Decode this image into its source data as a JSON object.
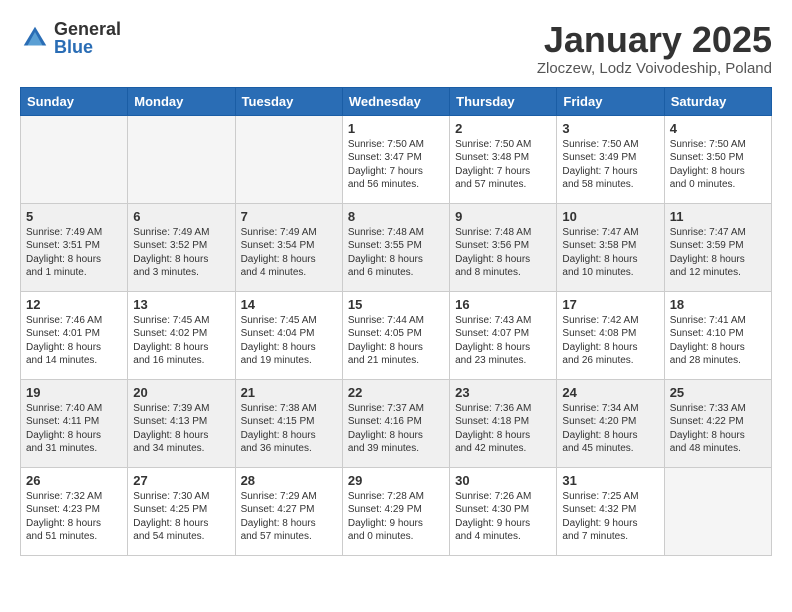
{
  "logo": {
    "general": "General",
    "blue": "Blue"
  },
  "title": "January 2025",
  "location": "Zloczew, Lodz Voivodeship, Poland",
  "weekdays": [
    "Sunday",
    "Monday",
    "Tuesday",
    "Wednesday",
    "Thursday",
    "Friday",
    "Saturday"
  ],
  "weeks": [
    {
      "shaded": false,
      "days": [
        {
          "num": "",
          "info": ""
        },
        {
          "num": "",
          "info": ""
        },
        {
          "num": "",
          "info": ""
        },
        {
          "num": "1",
          "info": "Sunrise: 7:50 AM\nSunset: 3:47 PM\nDaylight: 7 hours\nand 56 minutes."
        },
        {
          "num": "2",
          "info": "Sunrise: 7:50 AM\nSunset: 3:48 PM\nDaylight: 7 hours\nand 57 minutes."
        },
        {
          "num": "3",
          "info": "Sunrise: 7:50 AM\nSunset: 3:49 PM\nDaylight: 7 hours\nand 58 minutes."
        },
        {
          "num": "4",
          "info": "Sunrise: 7:50 AM\nSunset: 3:50 PM\nDaylight: 8 hours\nand 0 minutes."
        }
      ]
    },
    {
      "shaded": true,
      "days": [
        {
          "num": "5",
          "info": "Sunrise: 7:49 AM\nSunset: 3:51 PM\nDaylight: 8 hours\nand 1 minute."
        },
        {
          "num": "6",
          "info": "Sunrise: 7:49 AM\nSunset: 3:52 PM\nDaylight: 8 hours\nand 3 minutes."
        },
        {
          "num": "7",
          "info": "Sunrise: 7:49 AM\nSunset: 3:54 PM\nDaylight: 8 hours\nand 4 minutes."
        },
        {
          "num": "8",
          "info": "Sunrise: 7:48 AM\nSunset: 3:55 PM\nDaylight: 8 hours\nand 6 minutes."
        },
        {
          "num": "9",
          "info": "Sunrise: 7:48 AM\nSunset: 3:56 PM\nDaylight: 8 hours\nand 8 minutes."
        },
        {
          "num": "10",
          "info": "Sunrise: 7:47 AM\nSunset: 3:58 PM\nDaylight: 8 hours\nand 10 minutes."
        },
        {
          "num": "11",
          "info": "Sunrise: 7:47 AM\nSunset: 3:59 PM\nDaylight: 8 hours\nand 12 minutes."
        }
      ]
    },
    {
      "shaded": false,
      "days": [
        {
          "num": "12",
          "info": "Sunrise: 7:46 AM\nSunset: 4:01 PM\nDaylight: 8 hours\nand 14 minutes."
        },
        {
          "num": "13",
          "info": "Sunrise: 7:45 AM\nSunset: 4:02 PM\nDaylight: 8 hours\nand 16 minutes."
        },
        {
          "num": "14",
          "info": "Sunrise: 7:45 AM\nSunset: 4:04 PM\nDaylight: 8 hours\nand 19 minutes."
        },
        {
          "num": "15",
          "info": "Sunrise: 7:44 AM\nSunset: 4:05 PM\nDaylight: 8 hours\nand 21 minutes."
        },
        {
          "num": "16",
          "info": "Sunrise: 7:43 AM\nSunset: 4:07 PM\nDaylight: 8 hours\nand 23 minutes."
        },
        {
          "num": "17",
          "info": "Sunrise: 7:42 AM\nSunset: 4:08 PM\nDaylight: 8 hours\nand 26 minutes."
        },
        {
          "num": "18",
          "info": "Sunrise: 7:41 AM\nSunset: 4:10 PM\nDaylight: 8 hours\nand 28 minutes."
        }
      ]
    },
    {
      "shaded": true,
      "days": [
        {
          "num": "19",
          "info": "Sunrise: 7:40 AM\nSunset: 4:11 PM\nDaylight: 8 hours\nand 31 minutes."
        },
        {
          "num": "20",
          "info": "Sunrise: 7:39 AM\nSunset: 4:13 PM\nDaylight: 8 hours\nand 34 minutes."
        },
        {
          "num": "21",
          "info": "Sunrise: 7:38 AM\nSunset: 4:15 PM\nDaylight: 8 hours\nand 36 minutes."
        },
        {
          "num": "22",
          "info": "Sunrise: 7:37 AM\nSunset: 4:16 PM\nDaylight: 8 hours\nand 39 minutes."
        },
        {
          "num": "23",
          "info": "Sunrise: 7:36 AM\nSunset: 4:18 PM\nDaylight: 8 hours\nand 42 minutes."
        },
        {
          "num": "24",
          "info": "Sunrise: 7:34 AM\nSunset: 4:20 PM\nDaylight: 8 hours\nand 45 minutes."
        },
        {
          "num": "25",
          "info": "Sunrise: 7:33 AM\nSunset: 4:22 PM\nDaylight: 8 hours\nand 48 minutes."
        }
      ]
    },
    {
      "shaded": false,
      "days": [
        {
          "num": "26",
          "info": "Sunrise: 7:32 AM\nSunset: 4:23 PM\nDaylight: 8 hours\nand 51 minutes."
        },
        {
          "num": "27",
          "info": "Sunrise: 7:30 AM\nSunset: 4:25 PM\nDaylight: 8 hours\nand 54 minutes."
        },
        {
          "num": "28",
          "info": "Sunrise: 7:29 AM\nSunset: 4:27 PM\nDaylight: 8 hours\nand 57 minutes."
        },
        {
          "num": "29",
          "info": "Sunrise: 7:28 AM\nSunset: 4:29 PM\nDaylight: 9 hours\nand 0 minutes."
        },
        {
          "num": "30",
          "info": "Sunrise: 7:26 AM\nSunset: 4:30 PM\nDaylight: 9 hours\nand 4 minutes."
        },
        {
          "num": "31",
          "info": "Sunrise: 7:25 AM\nSunset: 4:32 PM\nDaylight: 9 hours\nand 7 minutes."
        },
        {
          "num": "",
          "info": ""
        }
      ]
    }
  ]
}
